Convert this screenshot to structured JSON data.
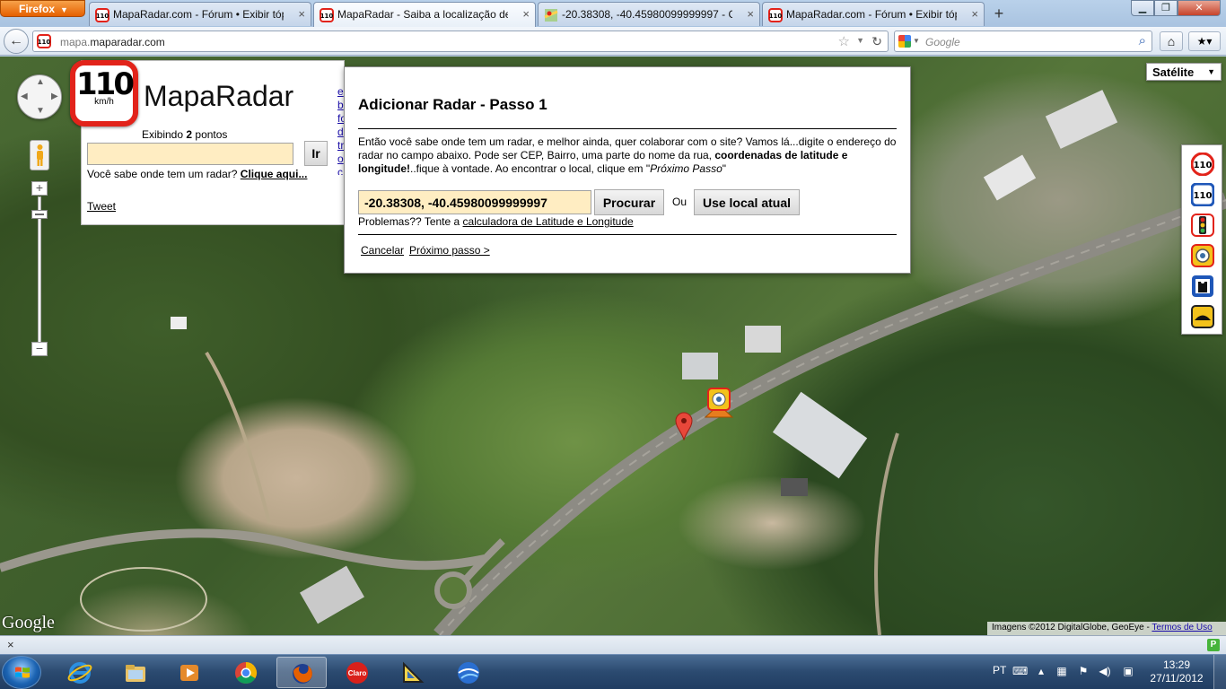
{
  "browser": {
    "menu_button": "Firefox",
    "tabs": [
      {
        "label": "MapaRadar.com - Fórum • Exibir tópi...",
        "active": false
      },
      {
        "label": "MapaRadar - Saiba a localização de t...",
        "active": true
      },
      {
        "label": "-20.38308, -40.45980099999997 - Goo...",
        "active": false
      },
      {
        "label": "MapaRadar.com - Fórum • Exibir tópi...",
        "active": false
      }
    ],
    "url_prefix": "mapa.",
    "url_domain": "maparadar.com",
    "search_placeholder": "Google"
  },
  "map": {
    "map_type": "Satélite",
    "google_logo": "Google",
    "attribution": "Imagens ©2012 DigitalGlobe, GeoEye - ",
    "terms_link": "Termos de Uso"
  },
  "site": {
    "logo_speed": "110",
    "logo_unit": "km/h",
    "logo_text": "MapaRadar",
    "showing_prefix": "Exibindo ",
    "showing_count": "2",
    "showing_suffix": " pontos",
    "go_button": "Ir",
    "question_text": "Você sabe onde tem um radar? ",
    "question_link": "Clique aqui...",
    "tweet": "Tweet",
    "clipped_links": [
      "e",
      "b",
      "fo",
      "d",
      "tr",
      "o",
      "c"
    ]
  },
  "dialog": {
    "title": "Adicionar Radar - Passo 1",
    "text_1": "Então você sabe onde tem um radar, e melhor ainda, quer colaborar com o site? Vamos lá...digite o endereço do radar no campo abaixo. Pode ser CEP, Bairro, uma parte do nome da rua, ",
    "text_bold": "coordenadas de latitude e longitude!",
    "text_2": "..fique à vontade. Ao encontrar o local, clique em \"",
    "text_italic": "Próximo Passo",
    "text_3": "\"",
    "coords_value": "-20.38308, -40.45980099999997",
    "search_button": "Procurar",
    "or_label": "Ou",
    "use_location_button": "Use local atual",
    "problems_text": "Problemas?? Tente a ",
    "problems_link": "calculadora de Latitude e Longitude",
    "cancel_link": "Cancelar",
    "next_link": "Próximo passo >"
  },
  "toolbar_icons": [
    "speed-110-icon",
    "speed-110-blue-icon",
    "traffic-light-icon",
    "radar-camera-icon",
    "police-icon",
    "speed-bump-icon"
  ],
  "statusbar": {
    "close": "×",
    "badge": "P"
  },
  "taskbar": {
    "apps": [
      "internet-explorer",
      "windows-explorer",
      "media-player",
      "chrome",
      "firefox",
      "claro",
      "geometry-app",
      "google-earth"
    ],
    "language": "PT",
    "time": "13:29",
    "date": "27/11/2012"
  }
}
